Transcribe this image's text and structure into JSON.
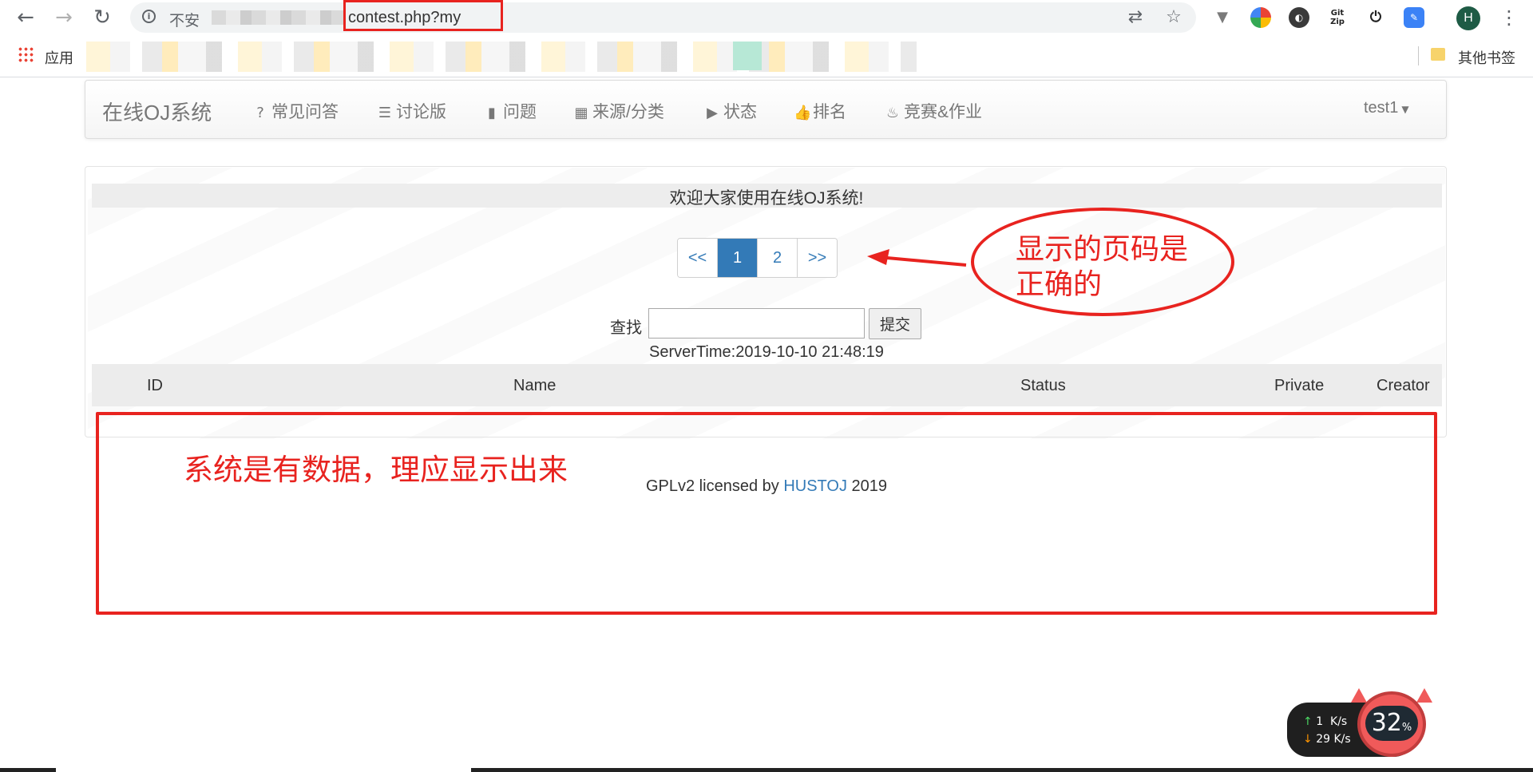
{
  "browser": {
    "not_secure_label": "不安",
    "url_visible": "contest.php?my",
    "avatar_letter": "H",
    "apps_label": "应用",
    "other_bookmarks_label": "其他书签",
    "extensions": [
      {
        "name": "vue-devtools-icon",
        "label": "V",
        "color": "#6f6f6f"
      },
      {
        "name": "colorful-ext-icon",
        "label": "",
        "color": "#4a90d9"
      },
      {
        "name": "dark-circle-ext-icon",
        "label": "",
        "color": "#3a3a3a"
      },
      {
        "name": "gitzip-ext-icon",
        "label": "Git Zip",
        "color": "#ffffff"
      },
      {
        "name": "power-ext-icon",
        "label": "⏻",
        "color": "#ffffff"
      },
      {
        "name": "blue-ext-icon",
        "label": "",
        "color": "#3b82f6"
      }
    ]
  },
  "navbar": {
    "brand": "在线OJ系统",
    "items": [
      {
        "icon": "question-circle-icon",
        "glyph": "?",
        "label": "常见问答"
      },
      {
        "icon": "list-icon",
        "glyph": "☰",
        "label": "讨论版"
      },
      {
        "icon": "book-icon",
        "glyph": "▮",
        "label": "问题"
      },
      {
        "icon": "grid-icon",
        "glyph": "▦",
        "label": "来源/分类"
      },
      {
        "icon": "play-circle-icon",
        "glyph": "▶",
        "label": "状态"
      },
      {
        "icon": "thumbs-up-icon",
        "glyph": "👍",
        "label": "排名"
      },
      {
        "icon": "fire-icon",
        "glyph": "♨",
        "label": "竞赛&作业"
      }
    ],
    "user": "test1"
  },
  "main": {
    "welcome": "欢迎大家使用在线OJ系统!",
    "pagination": [
      "<<",
      "1",
      "2",
      ">>"
    ],
    "active_page": "1",
    "search_label": "查找",
    "search_value": "",
    "submit_label": "提交",
    "server_time": "ServerTime:2019-10-10 21:48:19",
    "table_headers": [
      "ID",
      "Name",
      "Status",
      "Private",
      "Creator"
    ]
  },
  "footer": {
    "prefix": "GPLv2 licensed by ",
    "link": "HUSTOJ",
    "suffix": " 2019"
  },
  "annotations": {
    "pager_note": "显示的页码是正确的",
    "table_note": "系统是有数据，理应显示出来",
    "color": "#e8231f"
  },
  "net_widget": {
    "upload": "1",
    "download": "29",
    "unit": "K/s",
    "cpu_value": "32",
    "cpu_unit": "%"
  }
}
